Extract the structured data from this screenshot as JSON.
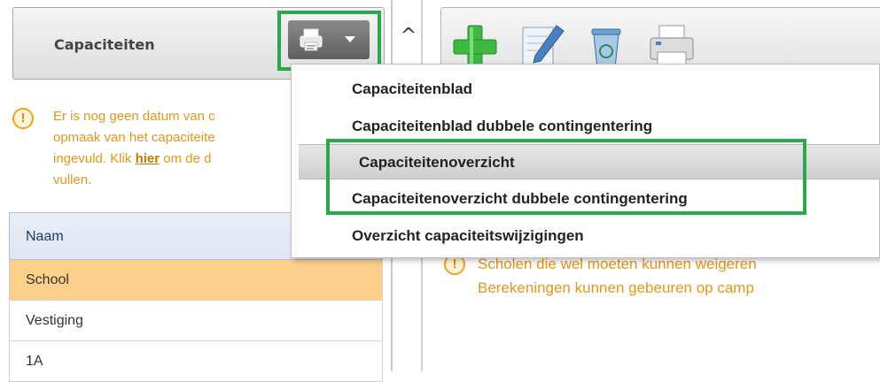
{
  "left_panel": {
    "title": "Capaciteiten",
    "collapse_glyph": "^",
    "warning": {
      "icon": "warning-icon",
      "line1": "Er is nog geen datum van c",
      "line2": "opmaak van het capaciteite",
      "line3_before": "ingevuld. Klik ",
      "line3_link": "hier",
      "line3_after": " om de d",
      "line4": "vullen."
    },
    "grid": {
      "header": "Naam",
      "rows": [
        "School",
        "Vestiging",
        "1A"
      ],
      "selected_index": 0
    }
  },
  "dropdown_menu": {
    "items": [
      "Capaciteitenblad",
      "Capaciteitenblad dubbele contingentering",
      "Capaciteitenoverzicht",
      "Capaciteitenoverzicht dubbele contingentering",
      "Overzicht capaciteitswijzigingen"
    ],
    "active_index": 2
  },
  "toolbar": {
    "tools": [
      "add-icon",
      "edit-icon",
      "recycle-bin-icon",
      "printer-icon"
    ]
  },
  "right_panel": {
    "warning_line1": "Scholen die wel moeten kunnen weigeren",
    "warning_line2": "Berekeningen kunnen gebeuren op camp"
  },
  "colors": {
    "highlight": "#2aa84a",
    "warning": "#e5961a",
    "selected_row": "#fcd08a"
  }
}
